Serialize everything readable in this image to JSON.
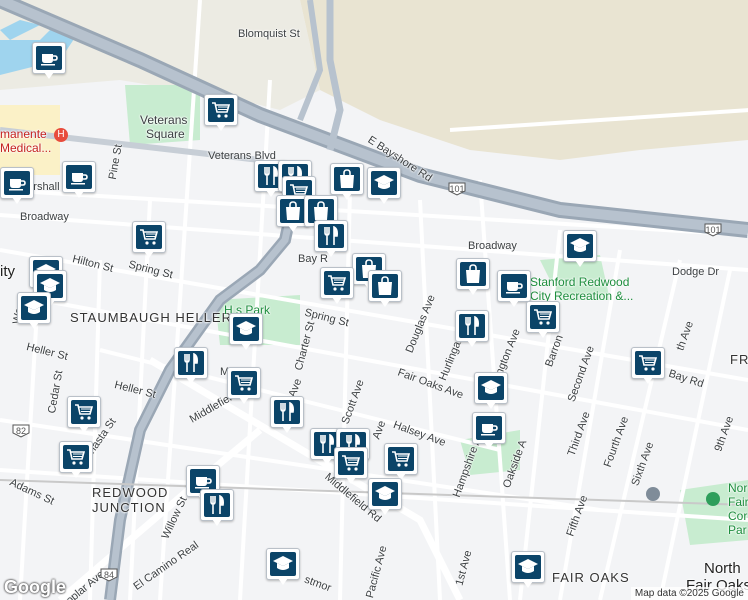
{
  "map": {
    "streets": {
      "blomquist": "Blomquist St",
      "e_bayshore": "E Bayshore Rd",
      "veterans_blvd": "Veterans Blvd",
      "marshall": "Marshall",
      "broadway_w": "Broadway",
      "broadway_e": "Broadway",
      "bay_rd_w": "Bay R",
      "bay_rd_e": "Bay Rd",
      "hilton": "Hilton St",
      "spring_w": "Spring St",
      "spring_e": "Spring St",
      "charter": "Charter St",
      "douglas": "Douglas Ave",
      "hurlingame": "Hurlingame",
      "warrington": "Warrington Ave",
      "barron": "Barron",
      "fair_oaks_ave": "Fair Oaks Ave",
      "scott": "Scott Ave",
      "halsey": "Halsey Ave",
      "hampshire": "Hampshire Ave",
      "oakside": "Oakside A",
      "second": "Second Ave",
      "third": "Third Ave",
      "fourth": "Fourth Ave",
      "fifth": "Fifth Ave",
      "sixth": "Sixth Ave",
      "ninth": "9th Ave",
      "seventh": "th Ave",
      "dodge": "Dodge Dr",
      "middlefield_1": "Middlefield Rd",
      "middlefield_2": "Middlefield Rd",
      "heller_w": "Heller St",
      "heller": "Heller St",
      "cedar": "Cedar St",
      "adams": "Adams St",
      "willow": "Willow St",
      "el_camino": "El Camino Real",
      "poplar": "Poplar Ave",
      "pacific": "Pacific Ave",
      "first": "1st Ave",
      "shasta": "hasta St",
      "pine": "Pine St",
      "wp": "Wo",
      "ave_frag": "Ave",
      "ave_frag2": "Ave",
      "ma": "Ma",
      "stmor": "stmor"
    },
    "areas": {
      "veterans_square_1": "Veterans",
      "veterans_square_2": "Square",
      "staumbaugh_heller": "STAUMBAUGH HELLER",
      "redwood_junction_1": "REDWOOD",
      "redwood_junction_2": "JUNCTION",
      "fair_oaks": "FAIR OAKS",
      "north_fair_oaks_1": "North",
      "north_fair_oaks_2": "Fair Oaks",
      "city": "ity",
      "fr": "FR",
      "kaiser_1": "manente",
      "kaiser_2": "Medical...",
      "hawes_park": "H   s Park",
      "stanford_1": "Stanford Redwood",
      "stanford_2": "City Recreation &...",
      "nor_1": "Nor",
      "nor_2": "Fair",
      "nor_3": "Cor",
      "nor_4": "Par"
    },
    "highways": {
      "us101_a": "101",
      "us101_b": "101",
      "ca82": "82",
      "ca84": "84"
    },
    "markers": [
      {
        "type": "cafe",
        "icon": "coffee-cup-icon"
      },
      {
        "type": "shopping",
        "icon": "shopping-cart-icon"
      },
      {
        "type": "restaurant",
        "icon": "fork-knife-icon"
      },
      {
        "type": "restaurant",
        "icon": "fork-knife-icon"
      },
      {
        "type": "shopping-bag",
        "icon": "shopping-bag-icon"
      },
      {
        "type": "school",
        "icon": "graduation-cap-icon"
      },
      {
        "type": "cafe",
        "icon": "coffee-cup-icon"
      },
      {
        "type": "shopping",
        "icon": "shopping-cart-icon"
      },
      {
        "type": "shopping-bag",
        "icon": "shopping-bag-icon"
      },
      {
        "type": "shopping-bag",
        "icon": "shopping-bag-icon"
      },
      {
        "type": "restaurant",
        "icon": "fork-knife-icon"
      },
      {
        "type": "cafe",
        "icon": "coffee-cup-icon"
      },
      {
        "type": "school",
        "icon": "graduation-cap-icon"
      },
      {
        "type": "shopping",
        "icon": "shopping-cart-icon"
      },
      {
        "type": "shopping-bag",
        "icon": "shopping-bag-icon"
      },
      {
        "type": "shopping",
        "icon": "shopping-cart-icon"
      },
      {
        "type": "shopping-bag",
        "icon": "shopping-bag-icon"
      },
      {
        "type": "shopping-bag",
        "icon": "shopping-bag-icon"
      },
      {
        "type": "cafe",
        "icon": "coffee-cup-icon"
      },
      {
        "type": "school",
        "icon": "graduation-cap-icon"
      },
      {
        "type": "school",
        "icon": "graduation-cap-icon"
      },
      {
        "type": "school",
        "icon": "graduation-cap-icon"
      },
      {
        "type": "shopping",
        "icon": "shopping-cart-icon"
      },
      {
        "type": "school",
        "icon": "graduation-cap-icon"
      },
      {
        "type": "restaurant",
        "icon": "fork-knife-icon"
      },
      {
        "type": "shopping",
        "icon": "shopping-cart-icon"
      },
      {
        "type": "shopping",
        "icon": "shopping-cart-icon"
      },
      {
        "type": "restaurant",
        "icon": "fork-knife-icon"
      },
      {
        "type": "shopping",
        "icon": "shopping-cart-icon"
      },
      {
        "type": "restaurant",
        "icon": "fork-knife-icon"
      },
      {
        "type": "restaurant",
        "icon": "fork-knife-icon"
      },
      {
        "type": "restaurant",
        "icon": "fork-knife-icon"
      },
      {
        "type": "shopping",
        "icon": "shopping-cart-icon"
      },
      {
        "type": "school",
        "icon": "graduation-cap-icon"
      },
      {
        "type": "school",
        "icon": "graduation-cap-icon"
      },
      {
        "type": "cafe",
        "icon": "coffee-cup-icon"
      },
      {
        "type": "shopping",
        "icon": "shopping-cart-icon"
      },
      {
        "type": "cafe",
        "icon": "coffee-cup-icon"
      },
      {
        "type": "restaurant",
        "icon": "fork-knife-icon"
      },
      {
        "type": "school",
        "icon": "graduation-cap-icon"
      },
      {
        "type": "school",
        "icon": "graduation-cap-icon"
      },
      {
        "type": "shopping",
        "icon": "shopping-cart-icon"
      }
    ],
    "logo": "Google",
    "attribution": "Map data ©2025 Google",
    "colors": {
      "marker_fill": "#0b4468",
      "highway": "#9aa7b5",
      "park": "#c8ecd0",
      "bay_land": "#e9e4d2"
    }
  }
}
